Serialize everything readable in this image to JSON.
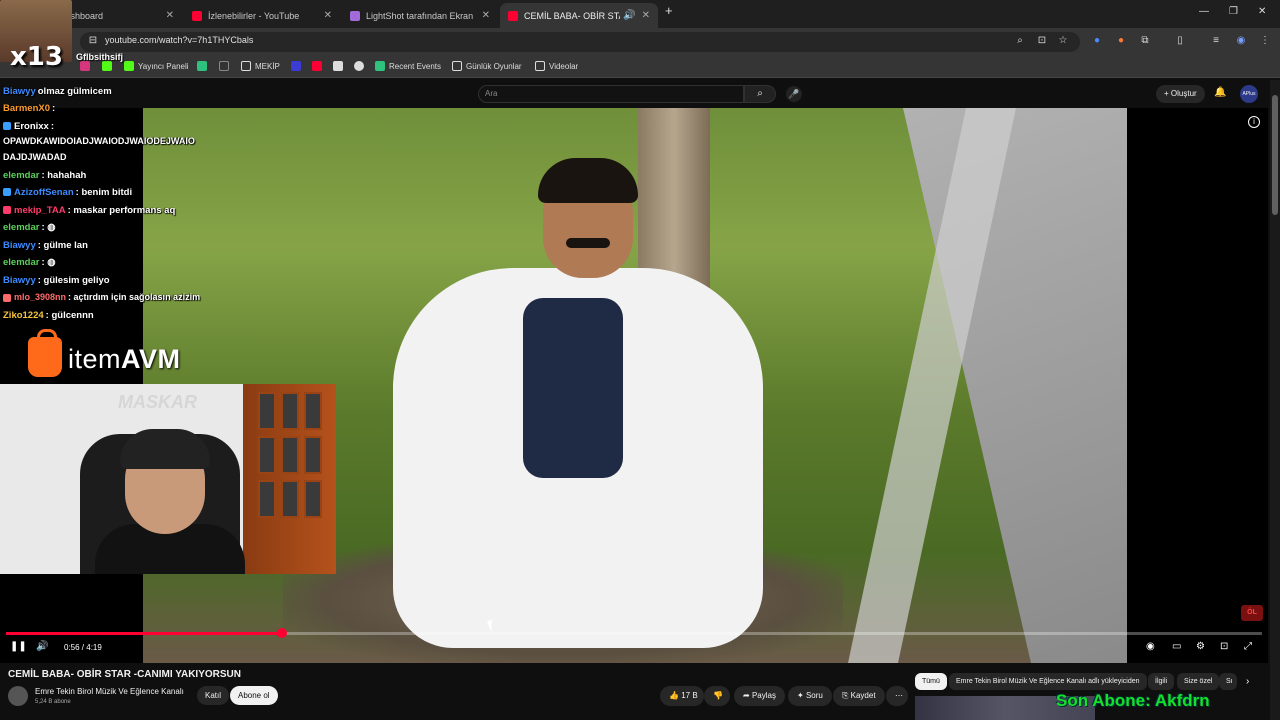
{
  "browser": {
    "tabs": [
      {
        "label": "m - Kick Dashboard",
        "favicon_color": "#53fc18"
      },
      {
        "label": "İzlenebilirler - YouTube",
        "favicon_color": "#ff0033"
      },
      {
        "label": "LightShot tarafından Ekran Gör",
        "favicon_color": "#a26bd8"
      },
      {
        "label": "CEMİL BABA- OBİR STAR -C",
        "favicon_color": "#ff0033",
        "active": true
      }
    ],
    "new_tab_icon": "plus-icon",
    "url": "youtube.com/watch?v=7h1THYCbals",
    "bookmarks": [
      {
        "label": "Yayıncı Paneli",
        "icon_color": "#53fc18"
      },
      {
        "label": "MEKİP",
        "icon": "folder-icon"
      },
      {
        "label": "Recent Events",
        "icon_color": "#2ec27e"
      },
      {
        "label": "Günlük Oyunlar",
        "icon": "folder-icon"
      },
      {
        "label": "Videolar",
        "icon": "folder-icon"
      }
    ]
  },
  "youtube": {
    "search_placeholder": "Ara",
    "create_label": "Oluştur",
    "profile_label": "APlus",
    "video": {
      "title": "CEMİL BABA- OBİR STAR -CANIMI YAKIYORSUN",
      "current_time": "0:56",
      "duration": "4:19",
      "time_display": "0:56 / 4:19",
      "progress_fraction": 0.22
    },
    "channel": {
      "name": "Emre Tekin Birol Müzik Ve Eğlence Kanalı",
      "subscribers": "5,24 B abone",
      "join_label": "Katıl",
      "subscribe_label": "Abone ol"
    },
    "actions": {
      "likes": "17 B",
      "share": "Paylaş",
      "ask": "Soru",
      "save": "Kaydet"
    },
    "chips": [
      "Tümü",
      "Emre Tekin Birol Müzik Ve Eğlence Kanalı adlı yükleyiciden",
      "İlgili",
      "Size özel",
      "Sı"
    ]
  },
  "overlay": {
    "multiplier": "x13",
    "streamer_name": "Gflbsithsifj",
    "chat": [
      {
        "user": "Biawyy",
        "text": "olmaz gülmicem",
        "color": "#3d8bff"
      },
      {
        "user": "BarmenX0",
        "text": ":",
        "color": "#ff9d2e"
      },
      {
        "user": "Eronixx",
        "text": ":",
        "color": "#ffffff"
      },
      {
        "user": "",
        "text": "OPAWDKAWIDOIADJWAIODJWAIODEJWAIO",
        "color": "#ffffff"
      },
      {
        "user": "",
        "text": "DAJDJWADAD",
        "color": "#ffffff"
      },
      {
        "user": "elemdar",
        "text": ": hahahah",
        "color": "#5bd05b"
      },
      {
        "user": "AzizoffSenan",
        "text": ": benim bitdi",
        "color": "#3d8bff"
      },
      {
        "user": "mekip_TAA",
        "text": ": maskar performans aq",
        "color": "#ff3b6b"
      },
      {
        "user": "elemdar",
        "text": ":",
        "color": "#5bd05b"
      },
      {
        "user": "Biawyy",
        "text": ": gülme lan",
        "color": "#3d8bff"
      },
      {
        "user": "elemdar",
        "text": ":",
        "color": "#5bd05b"
      },
      {
        "user": "Biawyy",
        "text": ": gülesim geliyo",
        "color": "#3d8bff"
      },
      {
        "user": "mlo_3908nn",
        "text": ": açtırdım için sağolasın azizim",
        "color": "#ff6b6b"
      },
      {
        "user": "Ziko1224",
        "text": ": gülcennn",
        "color": "#f5c542"
      }
    ],
    "sponsor": {
      "prefix": "item",
      "suffix": "AVM",
      "color": "#ff6a1a"
    },
    "webcam_text": "MASKAR",
    "bottom_text": "Son Abone: Akfdrn",
    "bottom_text_color": "#15e02b"
  }
}
